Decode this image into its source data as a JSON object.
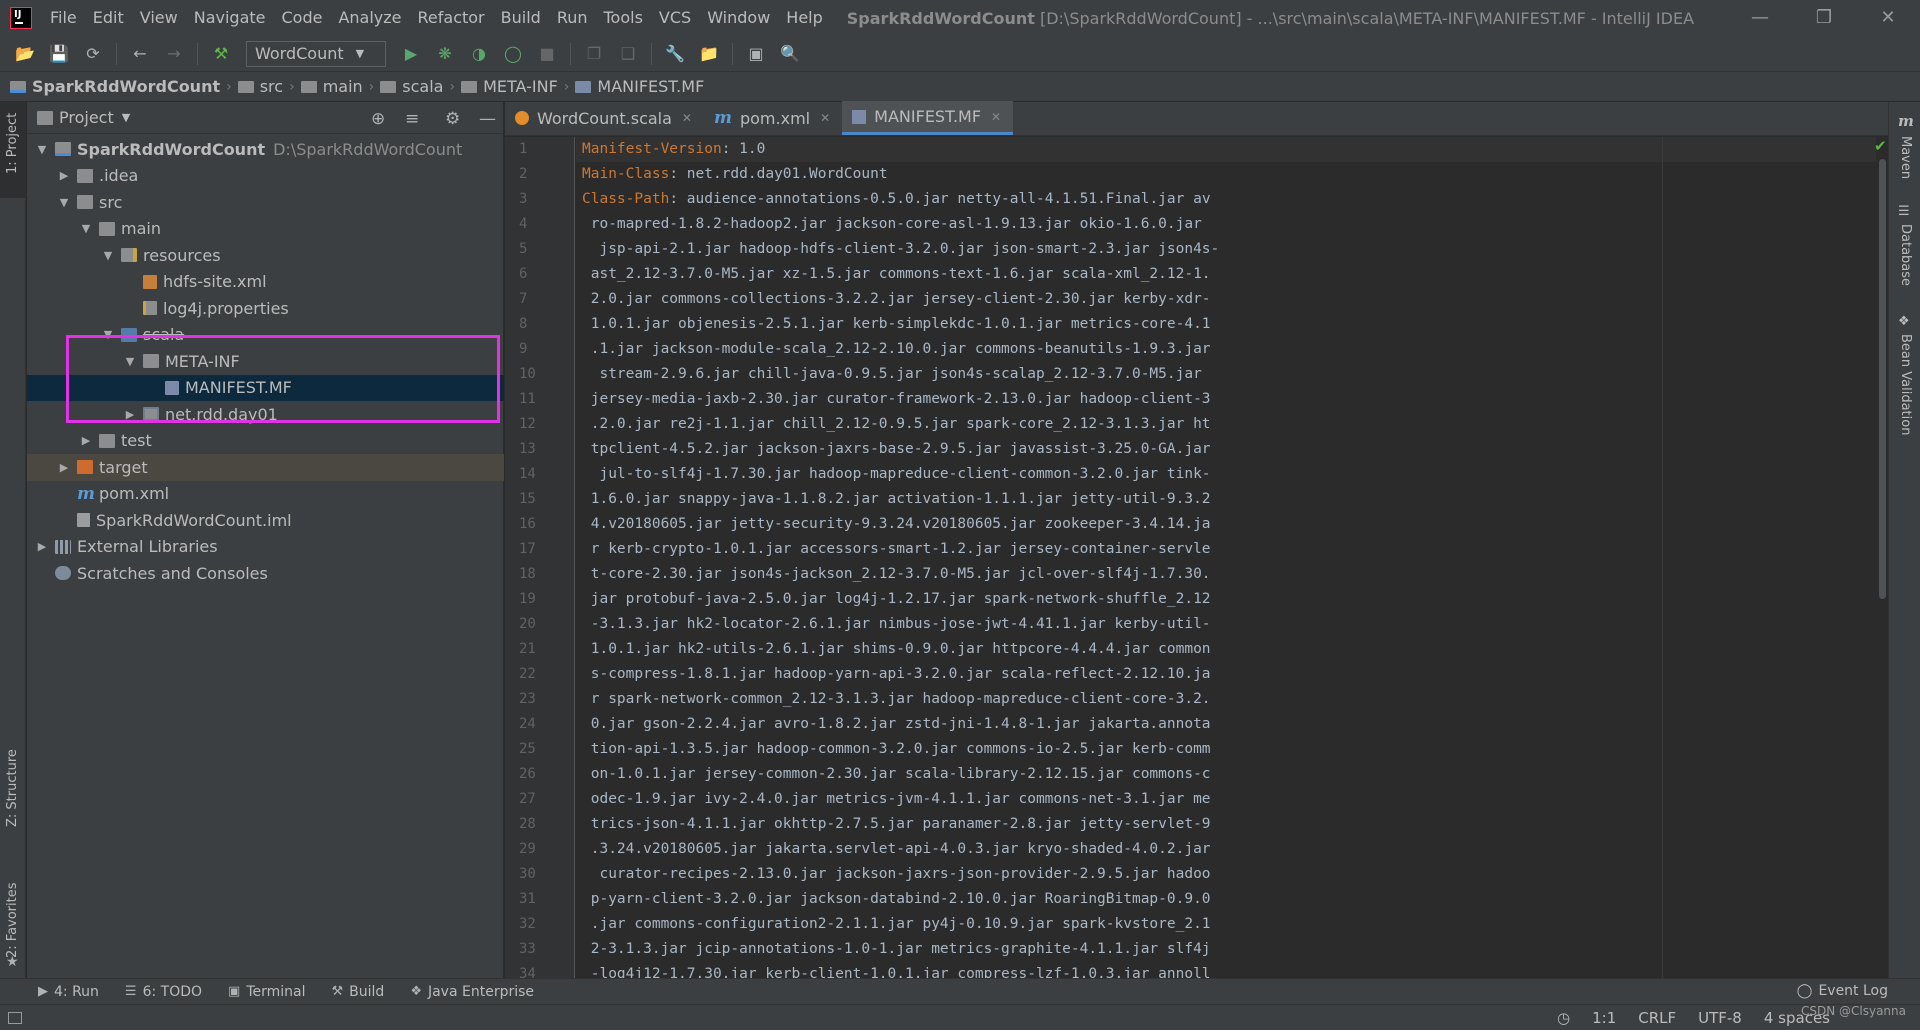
{
  "app": {
    "logo": "IJ",
    "project_name": "SparkRddWordCount",
    "title_rest": " [D:\\SparkRddWordCount] - ...\\src\\main\\scala\\META-INF\\MANIFEST.MF - IntelliJ IDEA"
  },
  "menu": [
    "File",
    "Edit",
    "View",
    "Navigate",
    "Code",
    "Analyze",
    "Refactor",
    "Build",
    "Run",
    "Tools",
    "VCS",
    "Window",
    "Help"
  ],
  "window_controls": {
    "minimize": "—",
    "restore": "❐",
    "close": "✕"
  },
  "toolbar": {
    "run_config": "WordCount",
    "icons": [
      "open-icon",
      "save-icon",
      "sync-icon",
      "back-icon",
      "forward-icon",
      "build-hammer-icon",
      "run-icon",
      "debug-icon",
      "coverage-icon",
      "profile-icon",
      "stop-icon",
      "attach-icon",
      "deploy-icon",
      "settings-wrench-icon",
      "project-structure-icon",
      "terminal-window-icon",
      "search-icon"
    ]
  },
  "breadcrumb": [
    "SparkRddWordCount",
    "src",
    "main",
    "scala",
    "META-INF",
    "MANIFEST.MF"
  ],
  "left_stripe": {
    "project": "1: Project",
    "structure": "Z: Structure",
    "favorites": "2: Favorites"
  },
  "right_stripe": {
    "maven": "Maven",
    "database": "Database",
    "bean": "Bean Validation"
  },
  "project_panel": {
    "title": "Project",
    "tree": [
      {
        "label": "SparkRddWordCount",
        "path": "D:\\SparkRddWordCount",
        "depth": 0,
        "expanded": true,
        "icon": "module"
      },
      {
        "label": ".idea",
        "depth": 1,
        "expanded": false,
        "icon": "folder"
      },
      {
        "label": "src",
        "depth": 1,
        "expanded": true,
        "icon": "folder"
      },
      {
        "label": "main",
        "depth": 2,
        "expanded": true,
        "icon": "folder"
      },
      {
        "label": "resources",
        "depth": 3,
        "expanded": true,
        "icon": "res"
      },
      {
        "label": "hdfs-site.xml",
        "depth": 4,
        "icon": "file-xml"
      },
      {
        "label": "log4j.properties",
        "depth": 4,
        "icon": "file-prop"
      },
      {
        "label": "scala",
        "depth": 3,
        "expanded": true,
        "icon": "folder-blue"
      },
      {
        "label": "META-INF",
        "depth": 4,
        "expanded": true,
        "icon": "folder"
      },
      {
        "label": "MANIFEST.MF",
        "depth": 5,
        "icon": "file-mf",
        "selected": true
      },
      {
        "label": "net.rdd.day01",
        "depth": 4,
        "expanded": false,
        "icon": "pkg"
      },
      {
        "label": "test",
        "depth": 2,
        "expanded": false,
        "icon": "folder"
      },
      {
        "label": "target",
        "depth": 1,
        "expanded": false,
        "icon": "folder-orange",
        "highlight": true
      },
      {
        "label": "pom.xml",
        "depth": 1,
        "icon": "pom"
      },
      {
        "label": "SparkRddWordCount.iml",
        "depth": 1,
        "icon": "iml"
      },
      {
        "label": "External Libraries",
        "depth": 0,
        "expanded": false,
        "icon": "lib"
      },
      {
        "label": "Scratches and Consoles",
        "depth": 0,
        "icon": "scratch"
      }
    ]
  },
  "editor_tabs": [
    {
      "label": "WordCount.scala",
      "icon": "scala"
    },
    {
      "label": "pom.xml",
      "icon": "pom"
    },
    {
      "label": "MANIFEST.MF",
      "icon": "mf",
      "active": true
    }
  ],
  "editor": {
    "lines": [
      {
        "key": "Manifest-Version",
        "value": ": 1.0"
      },
      {
        "key": "Main-Class",
        "value": ": net.rdd.day01.WordCount"
      },
      {
        "key": "Class-Path",
        "value": ": audience-annotations-0.5.0.jar netty-all-4.1.51.Final.jar av"
      },
      {
        "value": " ro-mapred-1.8.2-hadoop2.jar jackson-core-asl-1.9.13.jar okio-1.6.0.jar"
      },
      {
        "value": "  jsp-api-2.1.jar hadoop-hdfs-client-3.2.0.jar json-smart-2.3.jar json4s-"
      },
      {
        "value": " ast_2.12-3.7.0-M5.jar xz-1.5.jar commons-text-1.6.jar scala-xml_2.12-1."
      },
      {
        "value": " 2.0.jar commons-collections-3.2.2.jar jersey-client-2.30.jar kerby-xdr-"
      },
      {
        "value": " 1.0.1.jar objenesis-2.5.1.jar kerb-simplekdc-1.0.1.jar metrics-core-4.1"
      },
      {
        "value": " .1.jar jackson-module-scala_2.12-2.10.0.jar commons-beanutils-1.9.3.jar"
      },
      {
        "value": "  stream-2.9.6.jar chill-java-0.9.5.jar json4s-scalap_2.12-3.7.0-M5.jar"
      },
      {
        "value": " jersey-media-jaxb-2.30.jar curator-framework-2.13.0.jar hadoop-client-3"
      },
      {
        "value": " .2.0.jar re2j-1.1.jar chill_2.12-0.9.5.jar spark-core_2.12-3.1.3.jar ht"
      },
      {
        "value": " tpclient-4.5.2.jar jackson-jaxrs-base-2.9.5.jar javassist-3.25.0-GA.jar"
      },
      {
        "value": "  jul-to-slf4j-1.7.30.jar hadoop-mapreduce-client-common-3.2.0.jar tink-"
      },
      {
        "value": " 1.6.0.jar snappy-java-1.1.8.2.jar activation-1.1.1.jar jetty-util-9.3.2"
      },
      {
        "value": " 4.v20180605.jar jetty-security-9.3.24.v20180605.jar zookeeper-3.4.14.ja"
      },
      {
        "value": " r kerb-crypto-1.0.1.jar accessors-smart-1.2.jar jersey-container-servle"
      },
      {
        "value": " t-core-2.30.jar json4s-jackson_2.12-3.7.0-M5.jar jcl-over-slf4j-1.7.30."
      },
      {
        "value": " jar protobuf-java-2.5.0.jar log4j-1.2.17.jar spark-network-shuffle_2.12"
      },
      {
        "value": " -3.1.3.jar hk2-locator-2.6.1.jar nimbus-jose-jwt-4.41.1.jar kerby-util-"
      },
      {
        "value": " 1.0.1.jar hk2-utils-2.6.1.jar shims-0.9.0.jar httpcore-4.4.4.jar common"
      },
      {
        "value": " s-compress-1.8.1.jar hadoop-yarn-api-3.2.0.jar scala-reflect-2.12.10.ja"
      },
      {
        "value": " r spark-network-common_2.12-3.1.3.jar hadoop-mapreduce-client-core-3.2."
      },
      {
        "value": " 0.jar gson-2.2.4.jar avro-1.8.2.jar zstd-jni-1.4.8-1.jar jakarta.annota"
      },
      {
        "value": " tion-api-1.3.5.jar hadoop-common-3.2.0.jar commons-io-2.5.jar kerb-comm"
      },
      {
        "value": " on-1.0.1.jar jersey-common-2.30.jar scala-library-2.12.15.jar commons-c"
      },
      {
        "value": " odec-1.9.jar ivy-2.4.0.jar metrics-jvm-4.1.1.jar commons-net-3.1.jar me"
      },
      {
        "value": " trics-json-4.1.1.jar okhttp-2.7.5.jar paranamer-2.8.jar jetty-servlet-9"
      },
      {
        "value": " .3.24.v20180605.jar jakarta.servlet-api-4.0.3.jar kryo-shaded-4.0.2.jar"
      },
      {
        "value": "  curator-recipes-2.13.0.jar jackson-jaxrs-json-provider-2.9.5.jar hadoo"
      },
      {
        "value": " p-yarn-client-3.2.0.jar jackson-databind-2.10.0.jar RoaringBitmap-0.9.0"
      },
      {
        "value": " .jar commons-configuration2-2.1.1.jar py4j-0.10.9.jar spark-kvstore_2.1"
      },
      {
        "value": " 2-3.1.3.jar jcip-annotations-1.0-1.jar metrics-graphite-4.1.1.jar slf4j"
      },
      {
        "value": " -log4j12-1.7.30.jar kerb-client-1.0.1.jar compress-lzf-1.0.3.jar annoll"
      }
    ]
  },
  "bottom_tools": [
    {
      "label": "4: Run",
      "icon": "run-triangle-icon"
    },
    {
      "label": "6: TODO",
      "icon": "todo-list-icon"
    },
    {
      "label": "Terminal",
      "icon": "terminal-icon"
    },
    {
      "label": "Build",
      "icon": "build-hammer-icon"
    },
    {
      "label": "Java Enterprise",
      "icon": "java-enterprise-icon"
    }
  ],
  "event_log": "Event Log",
  "status": {
    "position": "1:1",
    "line_sep": "CRLF",
    "encoding": "UTF-8",
    "indent": "4 spaces"
  },
  "watermark": "CSDN @Clsyanna",
  "colors": {
    "accent": "#4a88c7",
    "selection": "#0d293e",
    "annotation_box": "#e033e8",
    "manifest_key": "#cc7832"
  }
}
